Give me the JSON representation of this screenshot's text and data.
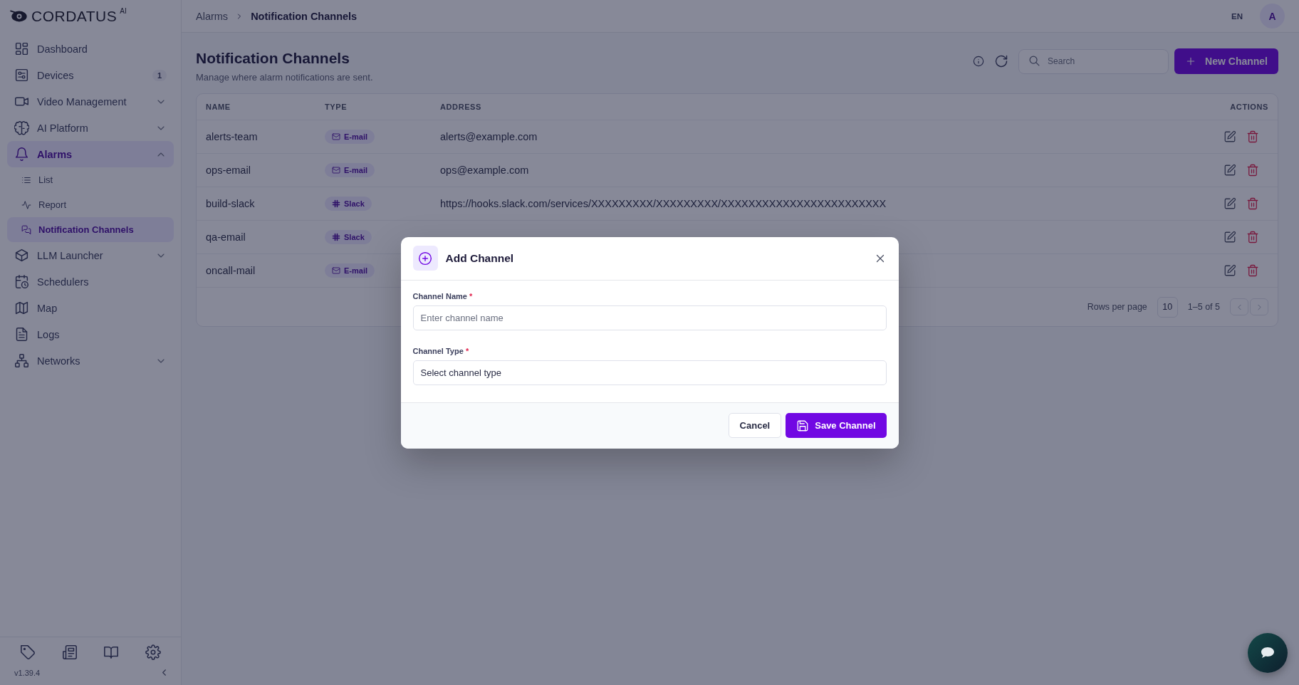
{
  "brand": {
    "name": "CORDATUS",
    "suffix": "AI"
  },
  "sidebar": {
    "items": [
      {
        "label": "Dashboard",
        "kind": "link",
        "selected": false
      },
      {
        "label": "Devices",
        "kind": "link",
        "selected": false,
        "badge": "1"
      },
      {
        "label": "Video Management",
        "kind": "group",
        "selected": false,
        "expanded": false
      },
      {
        "label": "AI Platform",
        "kind": "group",
        "selected": false,
        "expanded": false
      },
      {
        "label": "Alarms",
        "kind": "group",
        "selected": true,
        "expanded": true,
        "children": [
          {
            "label": "List",
            "selected": false
          },
          {
            "label": "Report",
            "selected": false
          },
          {
            "label": "Notification Channels",
            "selected": true
          }
        ]
      },
      {
        "label": "LLM Launcher",
        "kind": "group",
        "selected": false,
        "expanded": false
      },
      {
        "label": "Schedulers",
        "kind": "link",
        "selected": false
      },
      {
        "label": "Map",
        "kind": "link",
        "selected": false
      },
      {
        "label": "Logs",
        "kind": "link",
        "selected": false
      },
      {
        "label": "Networks",
        "kind": "group",
        "selected": false,
        "expanded": false
      }
    ],
    "version": "v1.39.4"
  },
  "breadcrumb": [
    "Alarms",
    "Notification Channels"
  ],
  "header": {
    "language": "EN",
    "avatar": "A"
  },
  "page": {
    "title": "Notification Channels",
    "subtitle": "Manage where alarm notifications are sent.",
    "search": {
      "placeholder": "Search"
    },
    "new_button": "New Channel"
  },
  "table": {
    "columns": [
      "NAME",
      "TYPE",
      "ADDRESS",
      "ACTIONS"
    ],
    "rows": [
      {
        "name": "alerts-team",
        "type": {
          "label": "E-mail",
          "kind": "email"
        },
        "address": "alerts@example.com"
      },
      {
        "name": "ops-email",
        "type": {
          "label": "E-mail",
          "kind": "email"
        },
        "address": "ops@example.com"
      },
      {
        "name": "build-slack",
        "type": {
          "label": "Slack",
          "kind": "slack"
        },
        "address": "https://hooks.slack.com/services/XXXXXXXXX/XXXXXXXXX/XXXXXXXXXXXXXXXXXXXXXXXX"
      },
      {
        "name": "qa-email",
        "type": {
          "label": "Slack",
          "kind": "slack"
        }
      },
      {
        "name": "oncall-mail",
        "type": {
          "label": "E-mail",
          "kind": "email"
        }
      }
    ],
    "rows_per_page_label": "Rows per page",
    "rows_per_page": "10",
    "range": "1–5 of 5"
  },
  "dialog": {
    "title": "Add Channel",
    "fields": [
      {
        "label": "Channel Name",
        "required": true,
        "required_mark": "*",
        "kind": "text",
        "placeholder": "Enter channel name"
      },
      {
        "label": "Channel Type",
        "required": true,
        "required_mark": "*",
        "kind": "select",
        "value": "Select channel type"
      }
    ],
    "buttons": {
      "cancel": "Cancel",
      "save": "Save Channel"
    }
  }
}
